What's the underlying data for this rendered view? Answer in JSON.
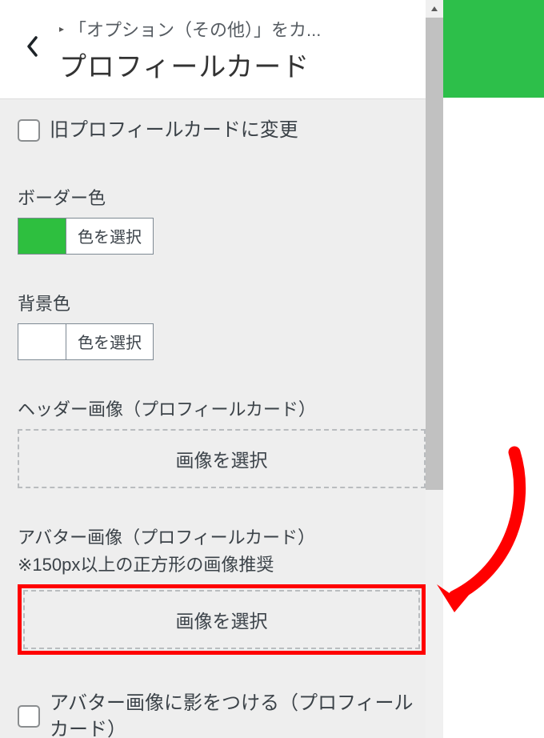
{
  "header": {
    "breadcrumb": "「オプション（その他）」をカ...",
    "title": "プロフィールカード"
  },
  "checkbox_change": {
    "label": "旧プロフィールカードに変更"
  },
  "border_color": {
    "label": "ボーダー色",
    "swatch": "#2ebf3f",
    "button": "色を選択"
  },
  "bg_color": {
    "label": "背景色",
    "swatch": "#ffffff",
    "button": "色を選択"
  },
  "header_image": {
    "label": "ヘッダー画像（プロフィールカード）",
    "button": "画像を選択"
  },
  "avatar_image": {
    "label": "アバター画像（プロフィールカード）",
    "note": "※150px以上の正方形の画像推奨",
    "button": "画像を選択"
  },
  "avatar_shadow": {
    "label": "アバター画像に影をつける（プロフィールカード）"
  }
}
